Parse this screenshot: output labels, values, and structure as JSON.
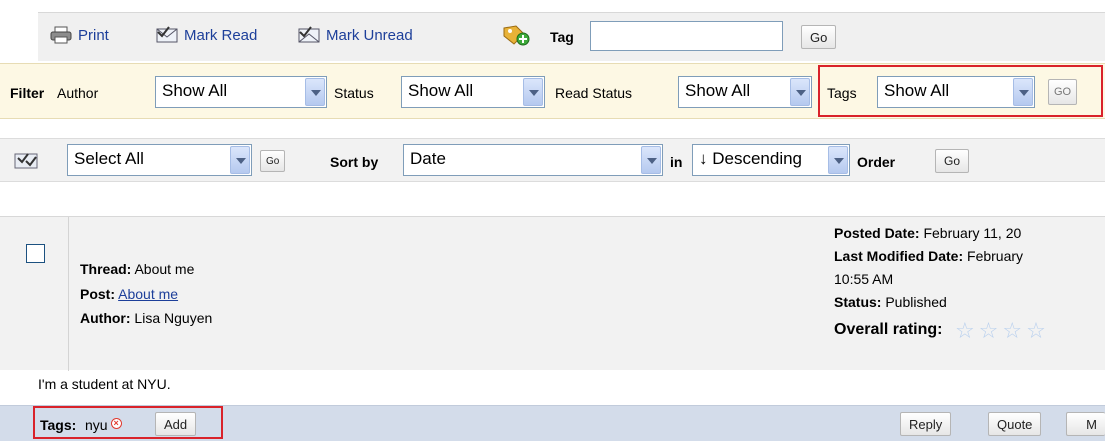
{
  "toolbar": {
    "print_label": "Print",
    "mark_read_label": "Mark Read",
    "mark_unread_label": "Mark Unread",
    "tag_label": "Tag",
    "tag_input_value": "",
    "go_label": "Go",
    "icons": [
      "printer-icon",
      "mark-read-icon",
      "mark-unread-icon",
      "tag-add-icon"
    ]
  },
  "filter": {
    "filter_label": "Filter",
    "author_label": "Author",
    "author_value": "Show All",
    "status_label": "Status",
    "status_value": "Show All",
    "read_status_label": "Read Status",
    "read_status_value": "Show All",
    "tags_label": "Tags",
    "tags_value": "Show All",
    "go_label": "GO",
    "highlight_color": "#d9222a"
  },
  "sort": {
    "select_value": "Select All",
    "select_go_label": "Go",
    "sort_by_label": "Sort by",
    "sort_by_value": "Date",
    "in_label": "in",
    "order_value": "↓ Descending",
    "order_label": "Order",
    "go_label": "Go"
  },
  "post": {
    "thread_label": "Thread:",
    "thread_value": " About me",
    "post_label": "Post:",
    "post_value": "About me",
    "author_label": "Author:",
    "author_value": " Lisa Nguyen",
    "posted_date_label": "Posted Date:",
    "posted_date_value": " February 11, 20",
    "last_modified_label": "Last Modified Date:",
    "last_modified_value": " February",
    "last_modified_time": "10:55 AM",
    "status_label": "Status:",
    "status_value": " Published",
    "overall_rating_label": "Overall rating:",
    "body": "I'm a student at NYU.",
    "tags_label": "Tags:",
    "tags": [
      "nyu"
    ],
    "add_label": "Add",
    "reply_label": "Reply",
    "quote_label": "Quote",
    "more_label": "M"
  }
}
